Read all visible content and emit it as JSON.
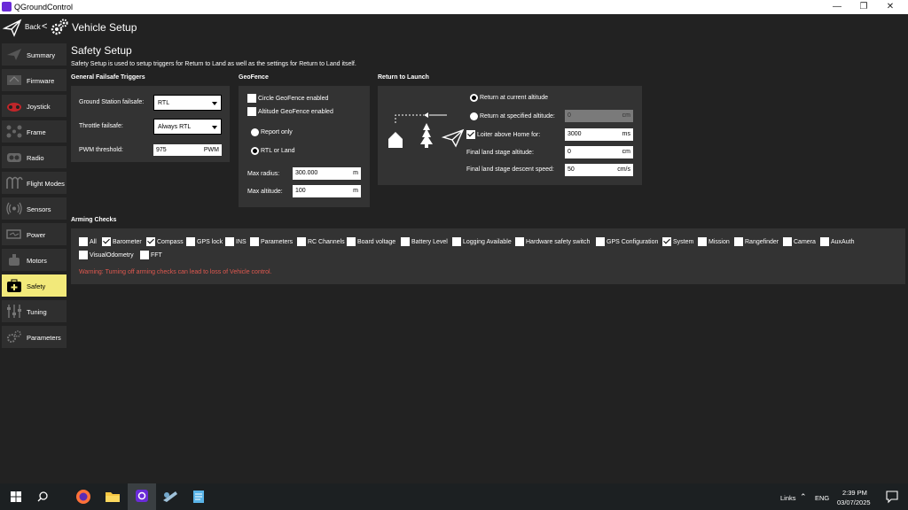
{
  "window": {
    "title": "QGroundControl"
  },
  "header": {
    "back": "Back",
    "chevron": "<",
    "title": "Vehicle Setup"
  },
  "sidebar": {
    "items": [
      {
        "label": "Summary"
      },
      {
        "label": "Firmware"
      },
      {
        "label": "Joystick"
      },
      {
        "label": "Frame"
      },
      {
        "label": "Radio"
      },
      {
        "label": "Flight Modes"
      },
      {
        "label": "Sensors"
      },
      {
        "label": "Power"
      },
      {
        "label": "Motors"
      },
      {
        "label": "Safety"
      },
      {
        "label": "Tuning"
      },
      {
        "label": "Parameters"
      }
    ],
    "active": "Safety"
  },
  "page": {
    "title": "Safety Setup",
    "description": "Safety Setup is used to setup triggers for Return to Land as well as the settings for Return to Land itself."
  },
  "failsafe": {
    "heading": "General Failsafe Triggers",
    "gcs_label": "Ground Station failsafe:",
    "gcs_value": "RTL",
    "throttle_label": "Throttle failsafe:",
    "throttle_value": "Always RTL",
    "pwm_label": "PWM threshold:",
    "pwm_value": "975",
    "pwm_unit": "PWM"
  },
  "geofence": {
    "heading": "GeoFence",
    "circle_label": "Circle GeoFence enabled",
    "circle_checked": false,
    "altitude_label": "Altitude GeoFence enabled",
    "altitude_checked": false,
    "report_only": "Report only",
    "rtl_or_land": "RTL or Land",
    "selected_action": "RTL or Land",
    "max_radius_label": "Max radius:",
    "max_radius_value": "300.000",
    "max_radius_unit": "m",
    "max_altitude_label": "Max altitude:",
    "max_altitude_value": "100",
    "max_altitude_unit": "m"
  },
  "rtl": {
    "heading": "Return to Launch",
    "current_alt": "Return at current altitude",
    "specified_alt": "Return at specified altitude:",
    "specified_value": "0",
    "specified_unit": "cm",
    "selected": "Return at current altitude",
    "loiter_label": "Loiter above Home for:",
    "loiter_checked": true,
    "loiter_value": "3000",
    "loiter_unit": "ms",
    "final_alt_label": "Final land stage altitude:",
    "final_alt_value": "0",
    "final_alt_unit": "cm",
    "descent_label": "Final land stage descent speed:",
    "descent_value": "50",
    "descent_unit": "cm/s"
  },
  "arming": {
    "heading": "Arming Checks",
    "checks": [
      {
        "label": "All",
        "checked": false
      },
      {
        "label": "Barometer",
        "checked": true
      },
      {
        "label": "Compass",
        "checked": true
      },
      {
        "label": "GPS lock",
        "checked": false
      },
      {
        "label": "INS",
        "checked": false
      },
      {
        "label": "Parameters",
        "checked": false
      },
      {
        "label": "RC Channels",
        "checked": false
      },
      {
        "label": "Board voltage",
        "checked": false
      },
      {
        "label": "Battery Level",
        "checked": false
      },
      {
        "label": "Logging Available",
        "checked": false
      },
      {
        "label": "Hardware safety switch",
        "checked": false
      },
      {
        "label": "GPS Configuration",
        "checked": false
      },
      {
        "label": "System",
        "checked": true
      },
      {
        "label": "Mission",
        "checked": false
      },
      {
        "label": "Rangefinder",
        "checked": false
      },
      {
        "label": "Camera",
        "checked": false
      },
      {
        "label": "AuxAuth",
        "checked": false
      },
      {
        "label": "VisualOdometry",
        "checked": false
      },
      {
        "label": "FFT",
        "checked": false
      }
    ],
    "warning": "Warning: Turning off arming checks can lead to loss of Vehicle control."
  },
  "taskbar": {
    "links": "Links",
    "lang": "ENG",
    "time": "2:39 PM",
    "date": "03/07/2025",
    "apps": [
      "start-icon",
      "search-icon",
      "firefox-icon",
      "file-explorer-icon",
      "qgroundcontrol-icon",
      "mission-planner-icon",
      "notepad-icon"
    ]
  },
  "colors": {
    "active_nav": "#f2e97a",
    "warning": "#e0584f",
    "panel": "#333333",
    "background": "#222222"
  }
}
